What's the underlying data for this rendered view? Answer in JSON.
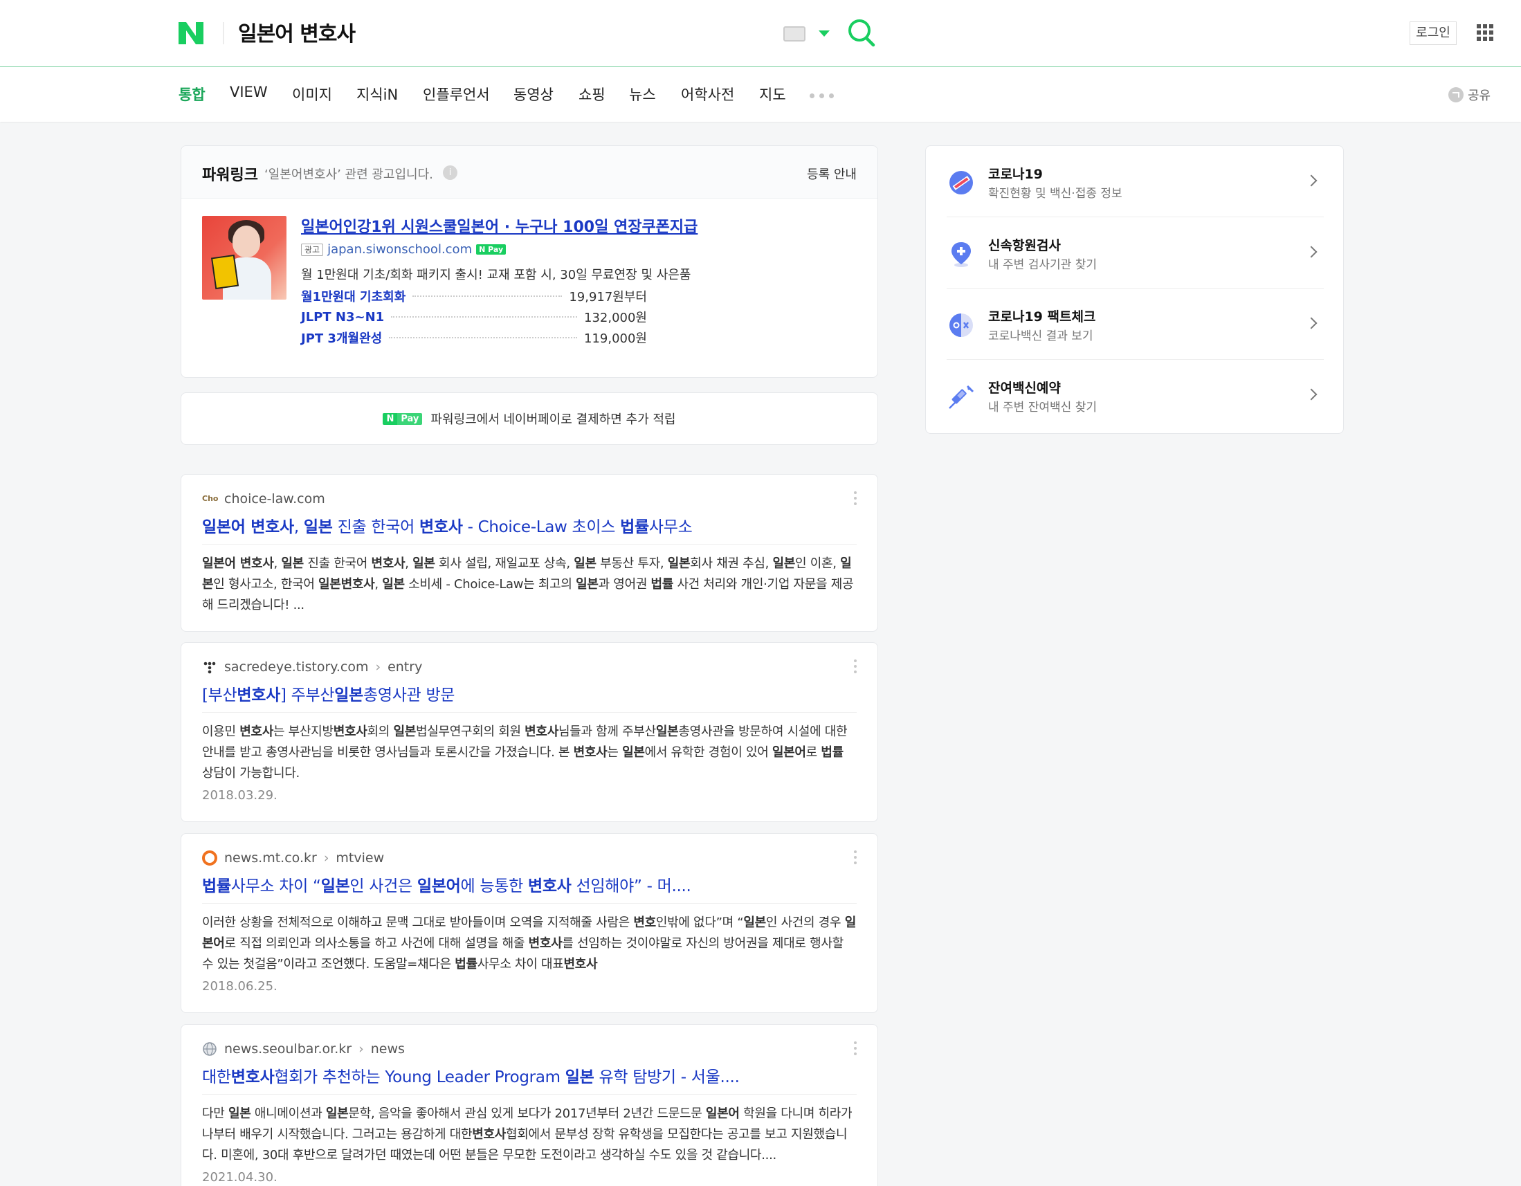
{
  "header": {
    "logo": "N",
    "query": "일본어 변호사",
    "login_label": "로그인",
    "keyboard_icon": "keyboard-icon",
    "search_icon": "search-icon",
    "apps_icon": "apps-grid-icon"
  },
  "tabs": [
    {
      "label": "통합",
      "active": true
    },
    {
      "label": "VIEW"
    },
    {
      "label": "이미지"
    },
    {
      "label": "지식iN"
    },
    {
      "label": "인플루언서"
    },
    {
      "label": "동영상"
    },
    {
      "label": "쇼핑"
    },
    {
      "label": "뉴스"
    },
    {
      "label": "어학사전"
    },
    {
      "label": "지도"
    }
  ],
  "share_label": "공유",
  "powerlink": {
    "title": "파워링크",
    "desc": "‘일본어변호사’ 관련 광고입니다.",
    "register_label": "등록 안내",
    "ad": {
      "title": "일본어인강1위 시원스쿨일본어 · 누구나 100일 연장쿠폰지급",
      "tag": "광고",
      "url": "japan.siwonschool.com",
      "npay": "N Pay",
      "desc": "월 1만원대 기초/회화 패키지 출시! 교재 포함 시, 30일 무료연장 및 사은품",
      "sublinks": [
        {
          "label": "월1만원대 기초회화",
          "price": "19,917원부터"
        },
        {
          "label": "JLPT N3~N1",
          "price": "132,000원"
        },
        {
          "label": "JPT 3개월완성",
          "price": "119,000원"
        }
      ]
    }
  },
  "npay_banner": {
    "badge_n": "N",
    "badge_pay": "Pay",
    "text": "파워링크에서 네이버페이로 결제하면 추가 적립"
  },
  "results": [
    {
      "domain": "choice-law.com",
      "crumb": "",
      "title": "일본어 변호사, 일본 진출 한국어 변호사 - Choice-Law 초이스 법률사무소",
      "snippet": "일본어 변호사, 일본 진출 한국어 변호사, 일본 회사 설립, 재일교포 상속, 일본 부동산 투자, 일본회사 채권 추심, 일본인 이혼, 일본인 형사고소, 한국어 일본변호사, 일본 소비세 - Choice-Law는 최고의 일본과 영어권 법률 사건 처리와 개인·기업 자문을 제공해 드리겠습니다! ...",
      "date": ""
    },
    {
      "domain": "sacredeye.tistory.com",
      "crumb": "entry",
      "title": "[부산변호사] 주부산일본총영사관 방문",
      "snippet": "이용민 변호사는 부산지방변호사회의 일본법실무연구회의 회원 변호사님들과 함께 주부산일본총영사관을 방문하여 시설에 대한 안내를 받고 총영사관님을 비롯한 영사님들과 토론시간을 가졌습니다. 본 변호사는 일본에서 유학한 경험이 있어 일본어로 법률 상담이 가능합니다.",
      "date": "2018.03.29."
    },
    {
      "domain": "news.mt.co.kr",
      "crumb": "mtview",
      "title": "법률사무소 차이 “일본인 사건은 일본어에 능통한 변호사 선임해야” - 머....",
      "snippet": "이러한 상황을 전체적으로 이해하고 문맥 그대로 받아들이며 오역을 지적해줄 사람은 변호인밖에 없다”며 “일본인 사건의 경우 일본어로 직접 의뢰인과 의사소통을 하고 사건에 대해 설명을 해줄 변호사를 선임하는 것이야말로 자신의 방어권을 제대로 행사할 수 있는 첫걸음”이라고 조언했다. 도움말=채다은 법률사무소 차이 대표변호사",
      "date": "2018.06.25."
    },
    {
      "domain": "news.seoulbar.or.kr",
      "crumb": "news",
      "title": "대한변호사협회가 추천하는 Young Leader Program 일본 유학 탐방기 - 서울....",
      "snippet": "다만 일본 애니메이션과 일본문학, 음악을 좋아해서 관심 있게 보다가 2017년부터 2년간 드문드문 일본어 학원을 다니며 히라가나부터 배우기 시작했습니다. 그러고는 용감하게 대한변호사협회에서 문부성 장학 유학생을 모집한다는 공고를 보고 지원했습니다. 미혼에, 30대 후반으로 달려가던 때였는데 어떤 분들은 무모한 도전이라고 생각하실 수도 있을 것 같습니다....",
      "date": "2021.04.30."
    }
  ],
  "sidebar": [
    {
      "title": "코로나19",
      "sub": "확진현황 및 백신·접종 정보",
      "icon": "covid-icon"
    },
    {
      "title": "신속항원검사",
      "sub": "내 주변 검사기관 찾기",
      "icon": "map-pin-plus-icon"
    },
    {
      "title": "코로나19 팩트체크",
      "sub": "코로나백신 결과 보기",
      "icon": "fact-check-icon"
    },
    {
      "title": "잔여백신예약",
      "sub": "내 주변 잔여백신 찾기",
      "icon": "syringe-icon"
    }
  ],
  "colors": {
    "brand": "#19ce60",
    "active_tab": "#19a658",
    "link": "#1a39c4"
  }
}
